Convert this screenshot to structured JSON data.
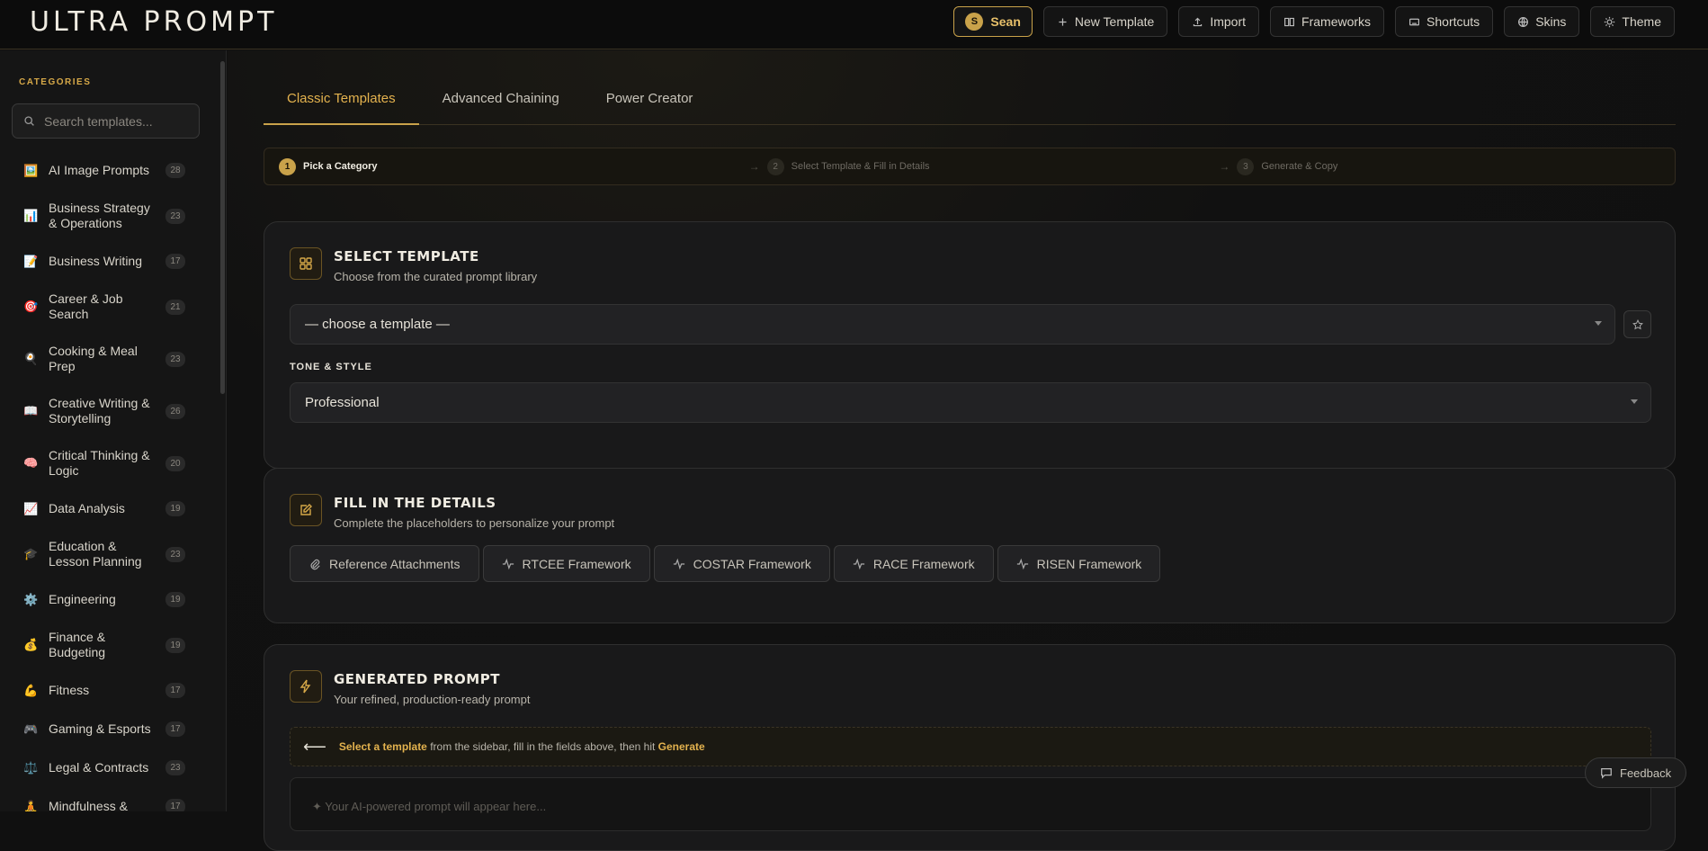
{
  "app": {
    "logo": "ULTRA PROMPT"
  },
  "header": {
    "user_initial": "S",
    "user_name": "Sean",
    "buttons": [
      {
        "label": "New Template",
        "icon": "plus-icon"
      },
      {
        "label": "Import",
        "icon": "upload-icon"
      },
      {
        "label": "Frameworks",
        "icon": "book-icon"
      },
      {
        "label": "Shortcuts",
        "icon": "keyboard-icon"
      },
      {
        "label": "Skins",
        "icon": "globe-icon"
      },
      {
        "label": "Theme",
        "icon": "sun-icon"
      }
    ]
  },
  "sidebar": {
    "title": "CATEGORIES",
    "search_placeholder": "Search templates...",
    "categories": [
      {
        "emoji": "🖼️",
        "label": "AI Image Prompts",
        "count": "28"
      },
      {
        "emoji": "📊",
        "label": "Business Strategy & Operations",
        "count": "23"
      },
      {
        "emoji": "📝",
        "label": "Business Writing",
        "count": "17"
      },
      {
        "emoji": "🎯",
        "label": "Career & Job Search",
        "count": "21"
      },
      {
        "emoji": "🍳",
        "label": "Cooking & Meal Prep",
        "count": "23"
      },
      {
        "emoji": "📖",
        "label": "Creative Writing & Storytelling",
        "count": "26"
      },
      {
        "emoji": "🧠",
        "label": "Critical Thinking & Logic",
        "count": "20"
      },
      {
        "emoji": "📈",
        "label": "Data Analysis",
        "count": "19"
      },
      {
        "emoji": "🎓",
        "label": "Education & Lesson Planning",
        "count": "23"
      },
      {
        "emoji": "⚙️",
        "label": "Engineering",
        "count": "19"
      },
      {
        "emoji": "💰",
        "label": "Finance & Budgeting",
        "count": "19"
      },
      {
        "emoji": "💪",
        "label": "Fitness",
        "count": "17"
      },
      {
        "emoji": "🎮",
        "label": "Gaming & Esports",
        "count": "17"
      },
      {
        "emoji": "⚖️",
        "label": "Legal & Contracts",
        "count": "23"
      },
      {
        "emoji": "🧘",
        "label": "Mindfulness &",
        "count": "17"
      }
    ]
  },
  "tabs": [
    {
      "label": "Classic Templates",
      "active": true
    },
    {
      "label": "Advanced Chaining",
      "active": false
    },
    {
      "label": "Power Creator",
      "active": false
    }
  ],
  "steps": [
    {
      "num": "1",
      "label": "Pick a Category"
    },
    {
      "num": "2",
      "label": "Select Template & Fill in Details"
    },
    {
      "num": "3",
      "label": "Generate & Copy"
    }
  ],
  "select_template": {
    "title": "SELECT TEMPLATE",
    "subtitle": "Choose from the curated prompt library",
    "template_value": "— choose a template —",
    "tone_label": "TONE & STYLE",
    "tone_value": "Professional"
  },
  "details": {
    "title": "FILL IN THE DETAILS",
    "subtitle": "Complete the placeholders to personalize your prompt",
    "buttons": [
      "Reference Attachments",
      "RTCEE Framework",
      "COSTAR Framework",
      "RACE Framework",
      "RISEN Framework"
    ]
  },
  "generated": {
    "title": "GENERATED PROMPT",
    "subtitle": "Your refined, production-ready prompt",
    "hint_arrow": "⟵",
    "hint_a": "Select a template",
    "hint_b": " from the sidebar, fill in the fields above, then hit ",
    "hint_c": "Generate",
    "output_placeholder": "✦ Your AI-powered prompt will appear here..."
  },
  "feedback_label": "Feedback",
  "colors": {
    "accent": "#c9a24a",
    "accent_text": "#e3b24e",
    "background": "#101010",
    "card": "#19191a"
  }
}
